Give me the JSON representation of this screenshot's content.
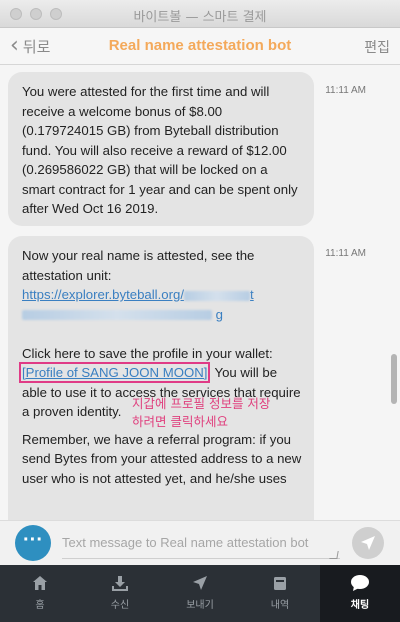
{
  "window": {
    "title": "바이트볼 — 스마트 결제"
  },
  "header": {
    "back_label": "뒤로",
    "title": "Real name attestation bot",
    "edit_label": "편집"
  },
  "messages": [
    {
      "time": "11:11 AM",
      "text": "You were attested for the first time and will receive a welcome bonus of $8.00 (0.179724015 GB) from Byteball distribution fund. You will also receive a reward of $12.00 (0.269586022 GB) that will be locked on a smart contract for 1 year and can be spent only after Wed Oct 16 2019."
    },
    {
      "time": "11:11 AM",
      "intro": "Now your real name is attested, see the attestation unit:",
      "link_prefix": "https://explorer.byteball.org/",
      "link_tail": "t",
      "save_prompt": "Click here to save the profile in your wallet:",
      "profile_link": "[Profile of SANG JOON MOON]",
      "after_link": ". You will be able to use it to access the services that require a proven identity.",
      "referral": "Remember, we have a referral program: if you send Bytes from your attested address to a new user who is not attested yet, and he/she uses"
    }
  ],
  "annotation": {
    "line1": "지갑에 프로필 정보를 저장",
    "line2": "하려면 클릭하세요",
    "color": "#e0407e"
  },
  "input": {
    "placeholder": "Text message to Real name attestation bot"
  },
  "tabs": [
    {
      "label": "홈",
      "icon": "home-icon"
    },
    {
      "label": "수신",
      "icon": "receive-icon"
    },
    {
      "label": "보내기",
      "icon": "send-icon"
    },
    {
      "label": "내역",
      "icon": "history-icon"
    },
    {
      "label": "채팅",
      "icon": "chat-icon",
      "active": true
    }
  ],
  "colors": {
    "accent": "#f4a95a",
    "link": "#3a7fc1",
    "highlight": "#e03b86",
    "tabbar": "#2b3036"
  }
}
